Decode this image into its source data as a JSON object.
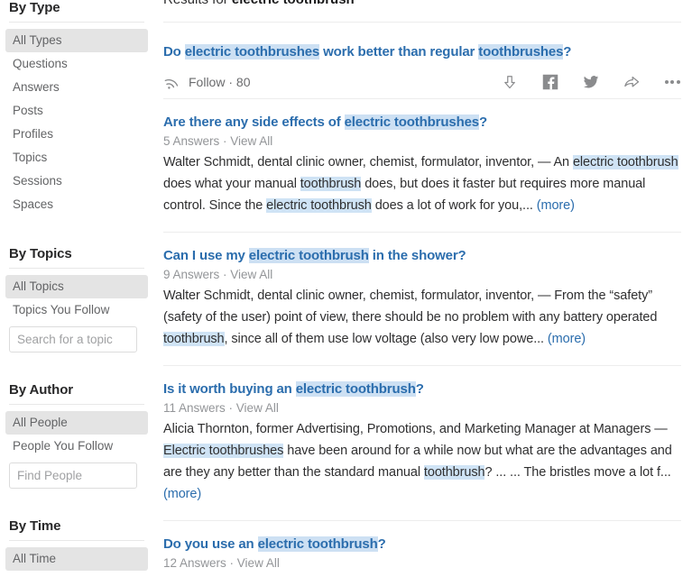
{
  "sidebar": {
    "facets": [
      {
        "id": "by-type",
        "title": "By Type",
        "items": [
          {
            "label": "All Types",
            "selected": true
          },
          {
            "label": "Questions",
            "selected": false
          },
          {
            "label": "Answers",
            "selected": false
          },
          {
            "label": "Posts",
            "selected": false
          },
          {
            "label": "Profiles",
            "selected": false
          },
          {
            "label": "Topics",
            "selected": false
          },
          {
            "label": "Sessions",
            "selected": false
          },
          {
            "label": "Spaces",
            "selected": false
          }
        ]
      },
      {
        "id": "by-topics",
        "title": "By Topics",
        "items": [
          {
            "label": "All Topics",
            "selected": true
          },
          {
            "label": "Topics You Follow",
            "selected": false
          }
        ],
        "input": {
          "placeholder": "Search for a topic",
          "value": ""
        }
      },
      {
        "id": "by-author",
        "title": "By Author",
        "items": [
          {
            "label": "All People",
            "selected": true
          },
          {
            "label": "People You Follow",
            "selected": false
          }
        ],
        "input": {
          "placeholder": "Find People",
          "value": ""
        }
      },
      {
        "id": "by-time",
        "title": "By Time",
        "items": [
          {
            "label": "All Time",
            "selected": true
          }
        ]
      }
    ]
  },
  "main": {
    "header": {
      "prefix": "Results for ",
      "query": "electric toothbrush"
    },
    "results": [
      {
        "title_parts": [
          {
            "t": "Do ",
            "hl": false
          },
          {
            "t": "electric toothbrushes",
            "hl": true
          },
          {
            "t": " work better than regular ",
            "hl": false
          },
          {
            "t": "toothbrushes",
            "hl": true
          },
          {
            "t": "?",
            "hl": false
          }
        ],
        "follow_label": "Follow",
        "follow_separator": "·",
        "follow_count": "80"
      },
      {
        "title_parts": [
          {
            "t": "Are there any side effects of ",
            "hl": false
          },
          {
            "t": "electric toothbrushes",
            "hl": true
          },
          {
            "t": "?",
            "hl": false
          }
        ],
        "answers": "5 Answers",
        "meta_separator": " · ",
        "view_all": "View All",
        "body_parts": [
          {
            "t": "Walter Schmidt, dental clinic owner, chemist, formulator, inventor, — An ",
            "hl": false
          },
          {
            "t": "electric toothbrush",
            "hl": true
          },
          {
            "t": " does what your manual ",
            "hl": false
          },
          {
            "t": "toothbrush",
            "hl": true
          },
          {
            "t": " does, but does it faster but requires more manual control. Since the ",
            "hl": false
          },
          {
            "t": "electric toothbrush",
            "hl": true
          },
          {
            "t": " does a lot of work for you,... ",
            "hl": false
          }
        ],
        "more_label": "(more)"
      },
      {
        "title_parts": [
          {
            "t": "Can I use my ",
            "hl": false
          },
          {
            "t": "electric toothbrush",
            "hl": true
          },
          {
            "t": " in the shower?",
            "hl": false
          }
        ],
        "answers": "9 Answers",
        "meta_separator": " · ",
        "view_all": "View All",
        "body_parts": [
          {
            "t": "Walter Schmidt, dental clinic owner, chemist, formulator, inventor, — From the “safety” (safety of the user) point of view, there should be no problem with any battery operated ",
            "hl": false
          },
          {
            "t": "toothbrush",
            "hl": true
          },
          {
            "t": ", since all of them use low voltage (also very low powe... ",
            "hl": false
          }
        ],
        "more_label": "(more)"
      },
      {
        "title_parts": [
          {
            "t": "Is it worth buying an ",
            "hl": false
          },
          {
            "t": "electric toothbrush",
            "hl": true
          },
          {
            "t": "?",
            "hl": false
          }
        ],
        "answers": "11 Answers",
        "meta_separator": " · ",
        "view_all": "View All",
        "body_parts": [
          {
            "t": "Alicia Thornton, former Advertising, Promotions, and Marketing Manager at Managers — ",
            "hl": false
          },
          {
            "t": "Electric toothbrushes",
            "hl": true
          },
          {
            "t": " have been around for a while now but what are the advantages and are they any better than the standard manual ",
            "hl": false
          },
          {
            "t": "toothbrush",
            "hl": true
          },
          {
            "t": "? ...   ...  The bristles move a lot f... ",
            "hl": false
          }
        ],
        "more_label": "(more)"
      },
      {
        "title_parts": [
          {
            "t": "Do you use an ",
            "hl": false
          },
          {
            "t": "electric toothbrush",
            "hl": true
          },
          {
            "t": "?",
            "hl": false
          }
        ],
        "answers": "12 Answers",
        "meta_separator": " · ",
        "view_all": "View All"
      }
    ],
    "action_icons": [
      {
        "name": "downvote-icon"
      },
      {
        "name": "facebook-share-icon"
      },
      {
        "name": "twitter-share-icon"
      },
      {
        "name": "share-icon"
      },
      {
        "name": "more-options-icon"
      }
    ]
  },
  "colors": {
    "link": "#2b6dad",
    "highlight": "#cfe3f5",
    "selected_facet": "#e4e4e4",
    "muted_text": "#939598"
  }
}
